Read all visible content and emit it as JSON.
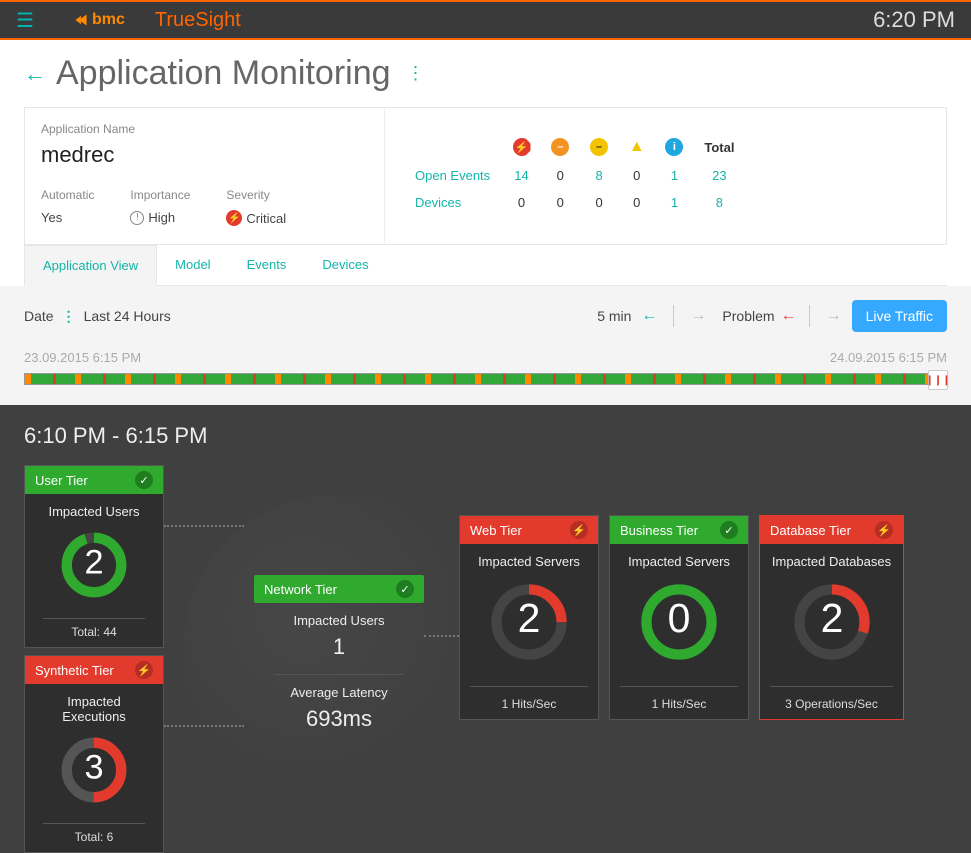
{
  "header": {
    "product": "TrueSight",
    "brand": "bmc",
    "clock": "6:20 PM"
  },
  "page": {
    "title": "Application Monitoring",
    "back": "←"
  },
  "app": {
    "name_label": "Application Name",
    "name": "medrec",
    "automatic_label": "Automatic",
    "automatic_value": "Yes",
    "importance_label": "Importance",
    "importance_value": "High",
    "severity_label": "Severity",
    "severity_value": "Critical"
  },
  "matrix": {
    "total_hdr": "Total",
    "rows": [
      {
        "name": "Open Events",
        "v": [
          "14",
          "0",
          "8",
          "0",
          "1",
          "23"
        ]
      },
      {
        "name": "Devices",
        "v": [
          "0",
          "0",
          "0",
          "0",
          "1",
          "8"
        ]
      }
    ]
  },
  "tabs": [
    "Application View",
    "Model",
    "Events",
    "Devices"
  ],
  "controls": {
    "date_label": "Date",
    "range": "Last 24 Hours",
    "step": "5 min",
    "problem": "Problem",
    "live": "Live Traffic"
  },
  "timeline": {
    "start": "23.09.2015 6:15 PM",
    "end": "24.09.2015 6:15 PM"
  },
  "dash": {
    "heading": "6:10 PM - 6:15 PM",
    "user": {
      "title": "User Tier",
      "metric": "Impacted Users",
      "value": "2",
      "total": "Total: 44"
    },
    "syn": {
      "title": "Synthetic Tier",
      "metric": "Impacted Executions",
      "value": "3",
      "total": "Total: 6"
    },
    "net": {
      "title": "Network Tier",
      "metric": "Impacted Users",
      "value": "1",
      "lat_label": "Average Latency",
      "lat": "693ms"
    },
    "web": {
      "title": "Web Tier",
      "metric": "Impacted Servers",
      "value": "2",
      "footer": "1 Hits/Sec"
    },
    "biz": {
      "title": "Business Tier",
      "metric": "Impacted Servers",
      "value": "0",
      "footer": "1 Hits/Sec"
    },
    "db": {
      "title": "Database Tier",
      "metric": "Impacted Databases",
      "value": "2",
      "footer": "3 Operations/Sec"
    }
  }
}
